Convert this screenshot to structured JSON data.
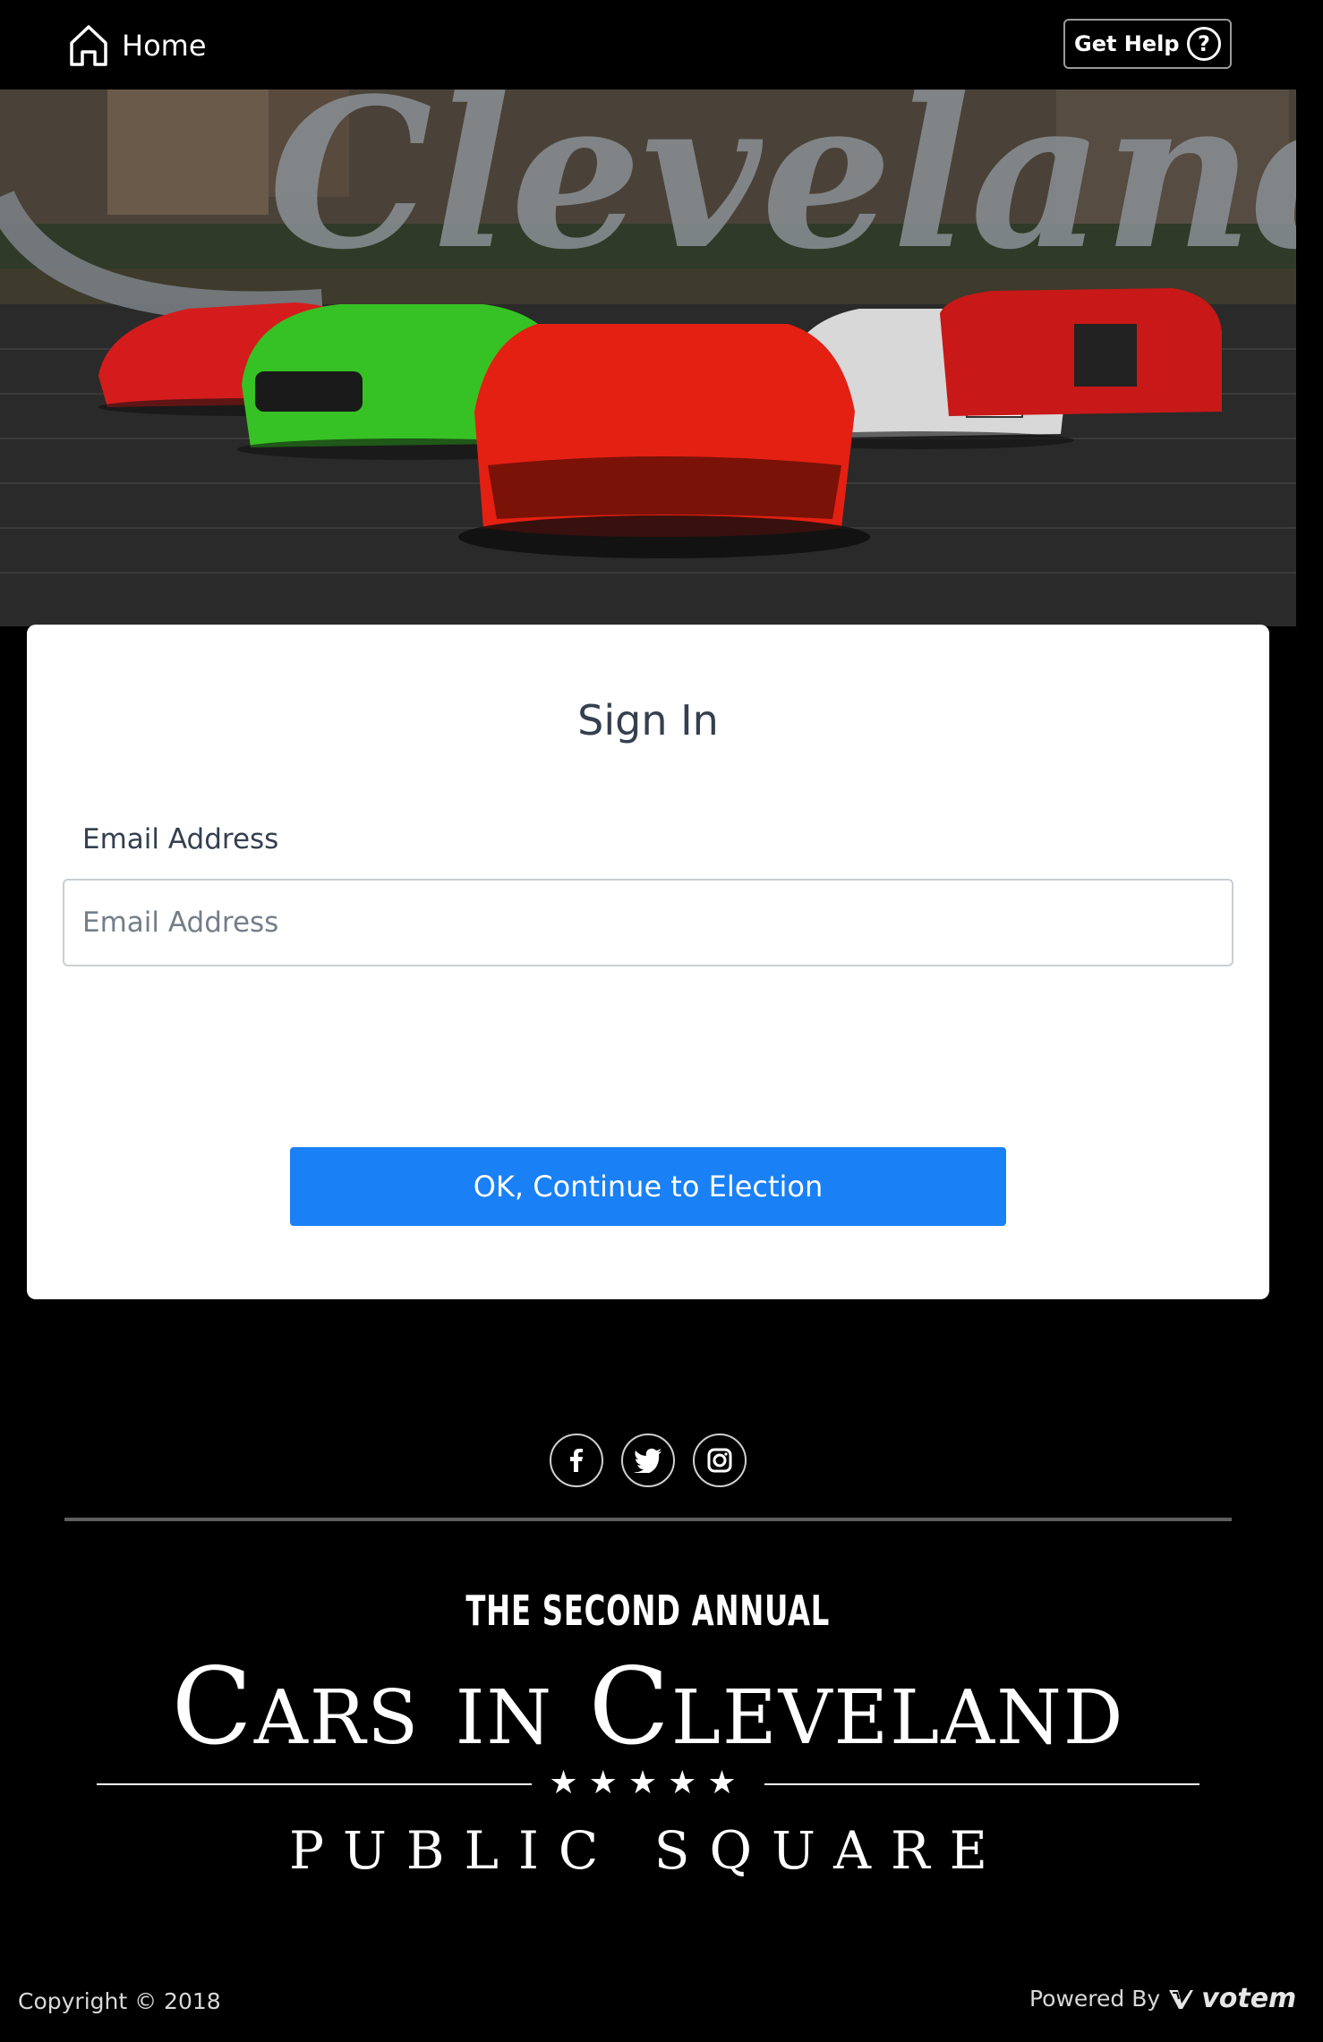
{
  "header": {
    "home_label": "Home",
    "help_label": "Get Help",
    "help_icon_glyph": "?"
  },
  "hero": {
    "alt": "Cleveland cars banner",
    "sign_text": "Cleveland"
  },
  "signin": {
    "title": "Sign In",
    "email_label": "Email Address",
    "email_placeholder": "Email Address",
    "email_value": "",
    "continue_label": "OK, Continue to Election"
  },
  "social": [
    "facebook-icon",
    "twitter-icon",
    "instagram-icon"
  ],
  "event": {
    "subtitle": "THE SECOND ANNUAL",
    "title": "Cars in Cleveland",
    "stars": "★★★★★",
    "location": "PUBLIC SQUARE"
  },
  "footer": {
    "copyright": "Copyright © 2018",
    "powered_by": "Powered By",
    "powered_logo": "votem"
  },
  "colors": {
    "background": "#000000",
    "card": "#ffffff",
    "primary_button": "#1a80f5",
    "heading_text": "#34404f"
  }
}
